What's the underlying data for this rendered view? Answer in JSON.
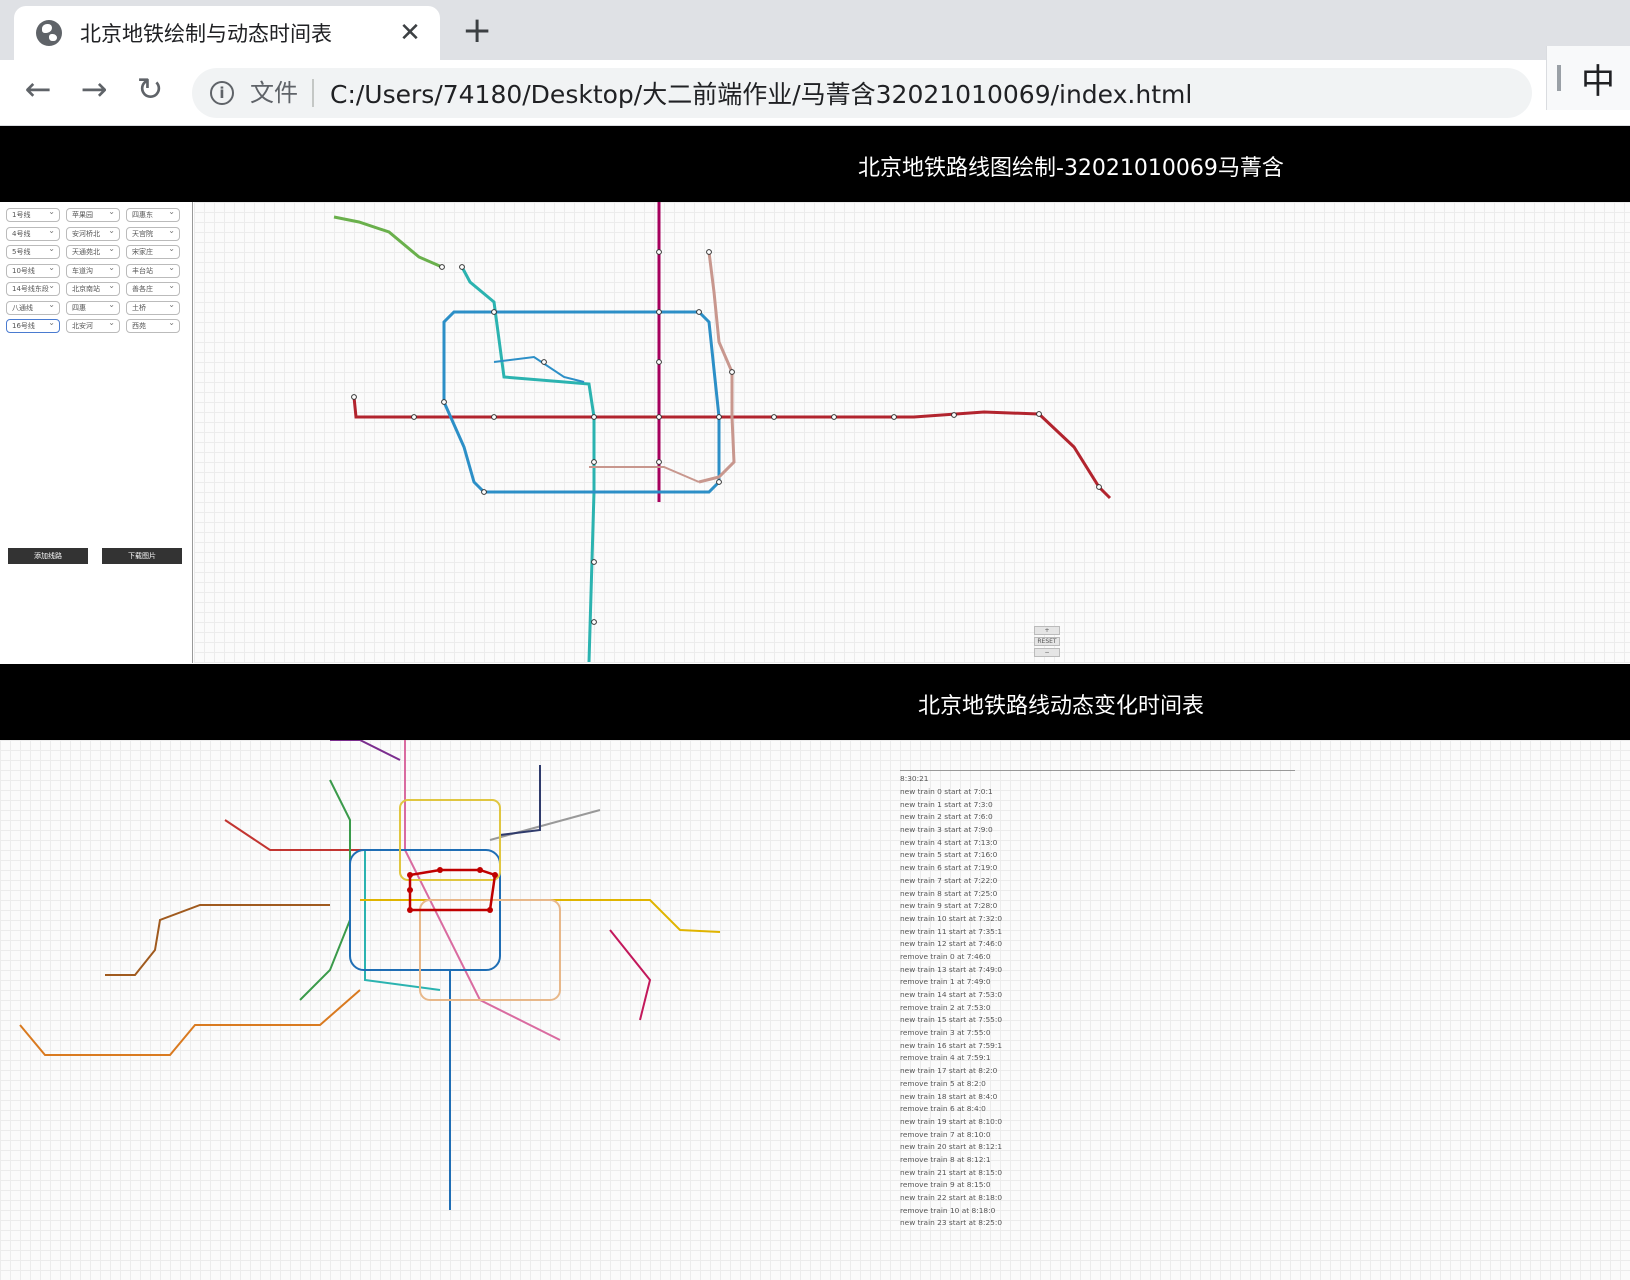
{
  "browser": {
    "tab_title": "北京地铁绘制与动态时间表",
    "new_tab": "+",
    "close": "✕",
    "security_label": "文件",
    "url": "C:/Users/74180/Desktop/大二前端作业/马菁含32021010069/index.html",
    "ime": "中"
  },
  "part1": {
    "title": "北京地铁路线图绘制-32021010069马菁含",
    "selects": [
      [
        "1号线",
        "苹果园",
        "四惠东"
      ],
      [
        "4号线",
        "安河桥北",
        "天宫院"
      ],
      [
        "5号线",
        "天通苑北",
        "宋家庄"
      ],
      [
        "10号线",
        "车道沟",
        "丰台站"
      ],
      [
        "14号线东段",
        "北京南站",
        "善各庄"
      ],
      [
        "八通线",
        "四惠",
        "土桥"
      ],
      [
        "16号线",
        "北安河",
        "西苑"
      ]
    ],
    "add_button": "添加线路",
    "download_button": "下载图片",
    "zoom_in": "+",
    "zoom_reset": "RESET",
    "zoom_out": "−",
    "colors": {
      "line1": "#b2242e",
      "line4": "#2bb3b0",
      "line5": "#a6005e",
      "line10": "#2c8fc7",
      "line14": "#c8978e",
      "batong": "#b2242e",
      "line16": "#6ab04c"
    }
  },
  "part2": {
    "title": "北京地铁路线动态变化时间表",
    "clock": "8:30:21",
    "log": [
      "new train 0 start at 7:0:1",
      "new train 1 start at 7:3:0",
      "new train 2 start at 7:6:0",
      "new train 3 start at 7:9:0",
      "new train 4 start at 7:13:0",
      "new train 5 start at 7:16:0",
      "new train 6 start at 7:19:0",
      "new train 7 start at 7:22:0",
      "new train 8 start at 7:25:0",
      "new train 9 start at 7:28:0",
      "new train 10 start at 7:32:0",
      "new train 11 start at 7:35:1",
      "new train 12 start at 7:46:0",
      "remove train 0 at 7:46:0",
      "new train 13 start at 7:49:0",
      "remove train 1 at 7:49:0",
      "new train 14 start at 7:53:0",
      "remove train 2 at 7:53:0",
      "new train 15 start at 7:55:0",
      "remove train 3 at 7:55:0",
      "new train 16 start at 7:59:1",
      "remove train 4 at 7:59:1",
      "new train 17 start at 8:2:0",
      "remove train 5 at 8:2:0",
      "new train 18 start at 8:4:0",
      "remove train 6 at 8:4:0",
      "new train 19 start at 8:10:0",
      "remove train 7 at 8:10:0",
      "new train 20 start at 8:12:1",
      "remove train 8 at 8:12:1",
      "new train 21 start at 8:15:0",
      "remove train 9 at 8:15:0",
      "new train 22 start at 8:18:0",
      "remove train 10 at 8:18:0",
      "new train 23 start at 8:25:0"
    ]
  }
}
